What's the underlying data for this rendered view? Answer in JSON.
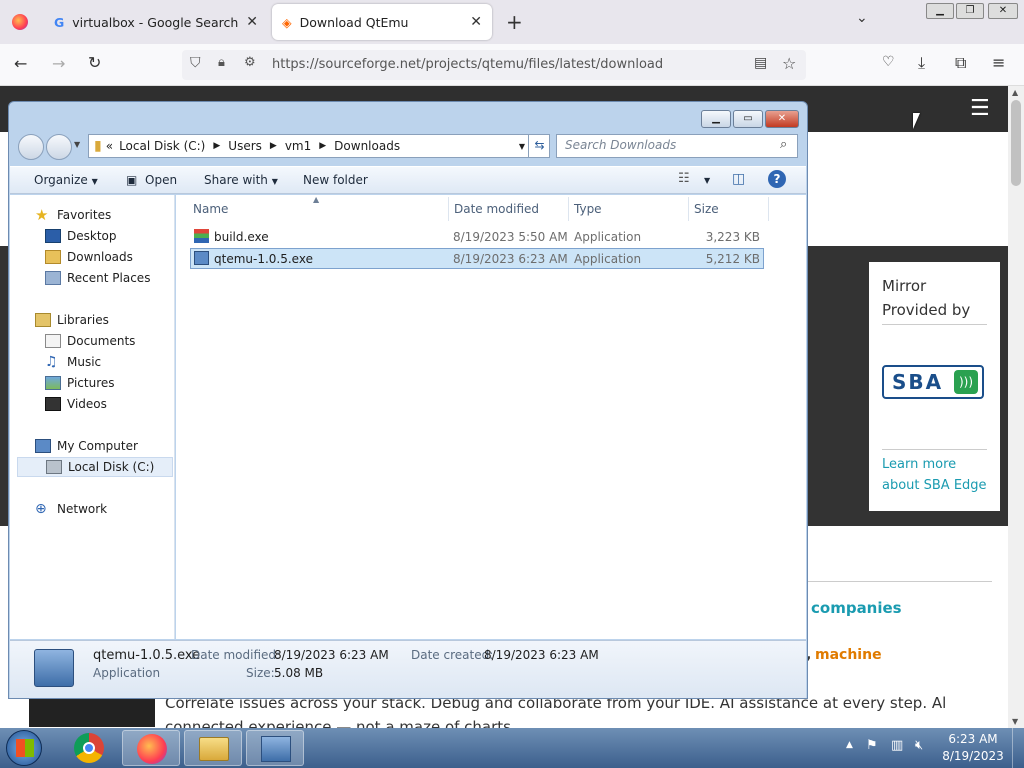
{
  "browser": {
    "tabs": [
      {
        "title": "virtualbox - Google Search"
      },
      {
        "title": "Download QtEmu"
      }
    ],
    "new_tab": "+",
    "url": "https://sourceforge.net/projects/qtemu/files/latest/download"
  },
  "page": {
    "mirror_title_1": "Mirror",
    "mirror_title_2": "Provided by",
    "sponsor_logo": "SBA",
    "learn_more_1": "Learn more",
    "learn_more_2": "about SBA Edge",
    "snippet_companies": "companies",
    "snippet_machine": "machine",
    "snippet_line": "Correlate issues across your stack. Debug and collaborate from your IDE. AI assistance at every step. All in one",
    "snippet_line2": "connected experience — not a maze of charts."
  },
  "explorer": {
    "breadcrumb": [
      "Local Disk (C:)",
      "Users",
      "vm1",
      "Downloads"
    ],
    "breadcrumb_prefix": "«",
    "search_placeholder": "Search Downloads",
    "toolbar": {
      "organize": "Organize",
      "open": "Open",
      "share_with": "Share with",
      "new_folder": "New folder"
    },
    "nav": {
      "favorites": "Favorites",
      "desktop": "Desktop",
      "downloads": "Downloads",
      "recent_places": "Recent Places",
      "libraries": "Libraries",
      "documents": "Documents",
      "music": "Music",
      "pictures": "Pictures",
      "videos": "Videos",
      "my_computer": "My Computer",
      "local_disk": "Local Disk (C:)",
      "network": "Network"
    },
    "columns": {
      "name": "Name",
      "date_modified": "Date modified",
      "type": "Type",
      "size": "Size"
    },
    "files": [
      {
        "name": "build.exe",
        "date": "8/19/2023 5:50 AM",
        "type": "Application",
        "size": "3,223 KB"
      },
      {
        "name": "qtemu-1.0.5.exe",
        "date": "8/19/2023 6:23 AM",
        "type": "Application",
        "size": "5,212 KB"
      }
    ],
    "details": {
      "name": "qtemu-1.0.5.exe",
      "type": "Application",
      "date_modified_label": "Date modified:",
      "date_modified": "8/19/2023 6:23 AM",
      "date_created_label": "Date created:",
      "date_created": "8/19/2023 6:23 AM",
      "size_label": "Size:",
      "size": "5.08 MB"
    }
  },
  "taskbar": {
    "time": "6:23 AM",
    "date": "8/19/2023"
  },
  "colors": {
    "accent_teal": "#1a9bb0",
    "accent_orange": "#e07b00",
    "selection": "#cce4f7"
  }
}
